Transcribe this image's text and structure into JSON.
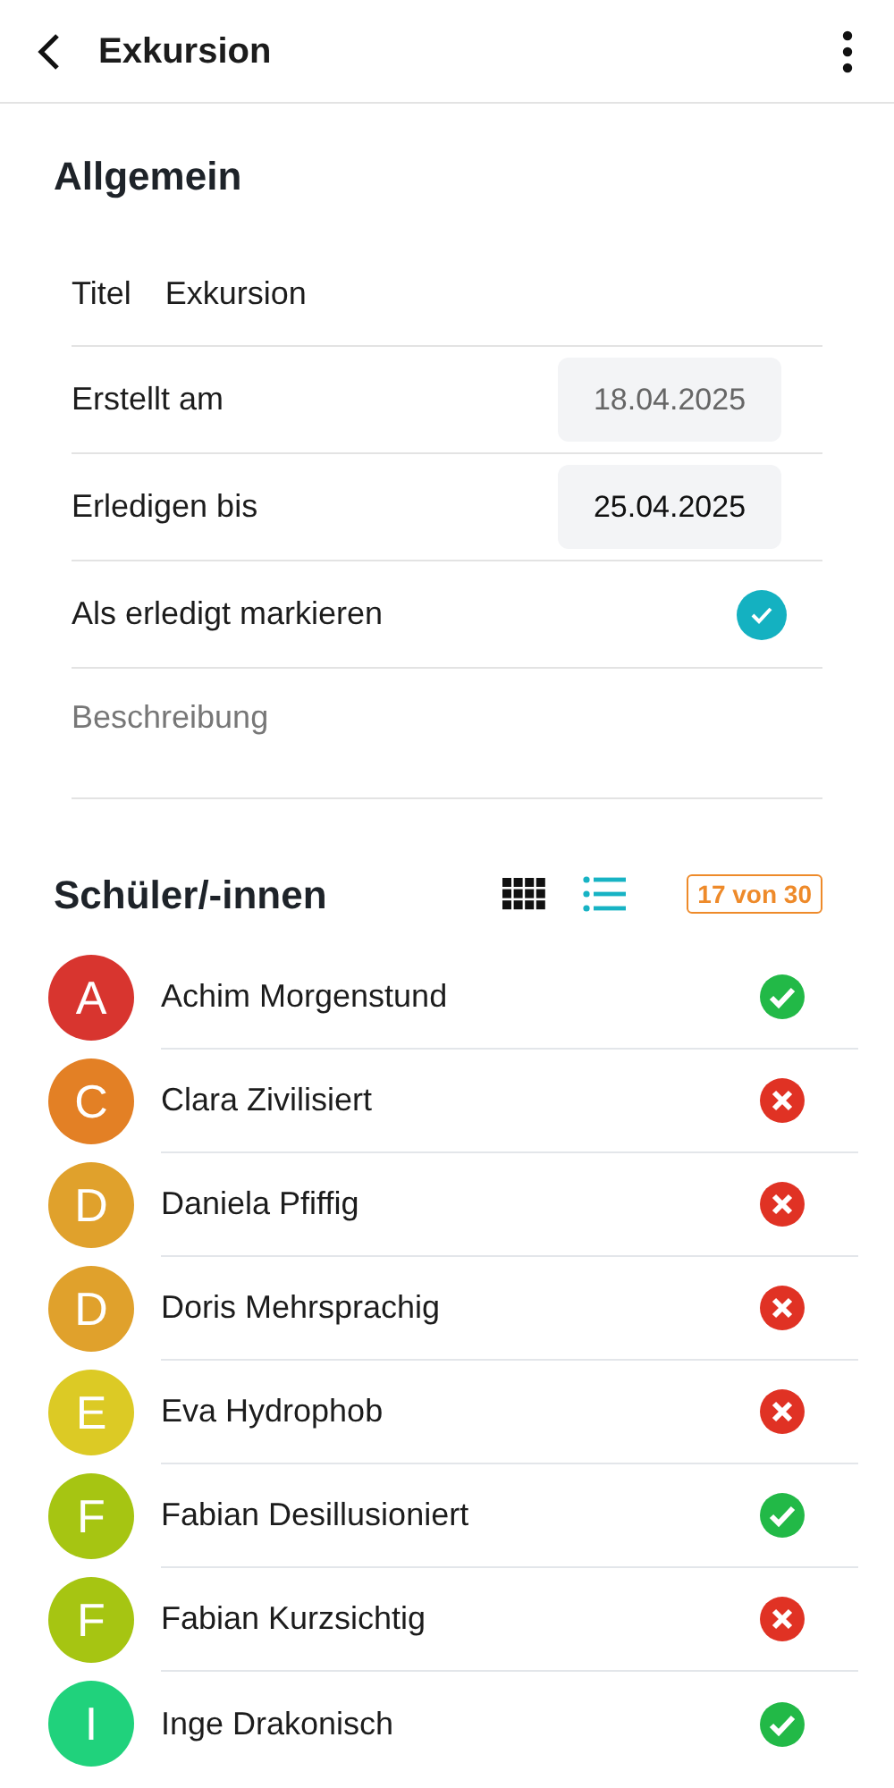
{
  "header": {
    "title": "Exkursion"
  },
  "section_general": {
    "heading": "Allgemein",
    "title_row": {
      "label": "Titel",
      "value": "Exkursion"
    },
    "date_rows": [
      {
        "label": "Erstellt am",
        "value": "18.04.2025",
        "disabled": true
      },
      {
        "label": "Erledigen bis",
        "value": "25.04.2025",
        "disabled": false
      }
    ],
    "done_row": {
      "label": "Als erledigt markieren",
      "checked": true
    },
    "description": {
      "placeholder": "Beschreibung"
    }
  },
  "section_students": {
    "heading": "Schüler/-innen",
    "view_modes": [
      {
        "kind": "grid",
        "selected": false
      },
      {
        "kind": "list",
        "selected": true
      }
    ],
    "count_badge": "17 von 30",
    "students": [
      {
        "initial": "A",
        "name": "Achim Morgenstund",
        "color": "#d8352f",
        "done": true
      },
      {
        "initial": "C",
        "name": "Clara Zivilisiert",
        "color": "#e38025",
        "done": false
      },
      {
        "initial": "D",
        "name": "Daniela Pfiffig",
        "color": "#e0a12c",
        "done": false
      },
      {
        "initial": "D",
        "name": "Doris Mehrsprachig",
        "color": "#e0a12c",
        "done": false
      },
      {
        "initial": "E",
        "name": "Eva Hydrophob",
        "color": "#dcca25",
        "done": false
      },
      {
        "initial": "F",
        "name": "Fabian Desillusioniert",
        "color": "#a6c512",
        "done": true
      },
      {
        "initial": "F",
        "name": "Fabian Kurzsichtig",
        "color": "#a6c512",
        "done": false
      },
      {
        "initial": "I",
        "name": "Inge Drakonisch",
        "color": "#20d27c",
        "done": true
      }
    ]
  }
}
